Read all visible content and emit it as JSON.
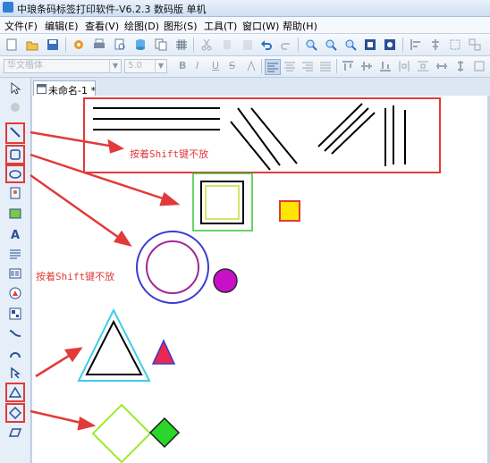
{
  "window": {
    "title": "中琅条码标签打印软件-V6.2.3 数码版 单机"
  },
  "menu": [
    {
      "label": "文件(F)"
    },
    {
      "label": "编辑(E)"
    },
    {
      "label": "查看(V)"
    },
    {
      "label": "绘图(D)"
    },
    {
      "label": "图形(S)"
    },
    {
      "label": "工具(T)"
    },
    {
      "label": "窗口(W)"
    },
    {
      "label": "帮助(H)"
    }
  ],
  "format_toolbar": {
    "font_family": "华文楷体",
    "font_size": "5.0",
    "bold": "B",
    "italic": "I",
    "underline": "U",
    "strike": "S"
  },
  "document_tab": {
    "label": "未命名-1 *"
  },
  "annotations": {
    "shift_hint_top": "按着Shift键不放",
    "shift_hint_left": "按着Shift键不放"
  },
  "colors": {
    "annotation_red": "#e23a3a",
    "rect_outer": "#32c832",
    "rect_middle": "#000000",
    "rect_inner": "#c8dc3c",
    "small_square_fill": "#ffe600",
    "small_square_border": "#e23a3a",
    "circle_outer": "#3c3cd2",
    "circle_inner": "#a02896",
    "small_circle_fill": "#c810c8",
    "triangle_outer": "#3ccfe8",
    "small_triangle_fill": "#e82850",
    "small_triangle_border": "#3c3cd2",
    "diamond_outer": "#9aea2c",
    "small_diamond_fill": "#2ad62a"
  },
  "left_tools": [
    "select-arrow-icon",
    "pan-hand-icon",
    "line-icon",
    "rectangle-icon",
    "ellipse-icon",
    "image-box-icon",
    "picture-icon",
    "text-icon",
    "paragraph-icon",
    "barcode-icon",
    "shape-library-icon",
    "qrcode-icon",
    "curve-icon",
    "arc-icon",
    "polyline-icon",
    "triangle-icon",
    "diamond-icon",
    "parallelogram-icon"
  ],
  "toolbar_icons": [
    "new-file-icon",
    "open-folder-icon",
    "save-icon",
    "settings-gear-icon",
    "print-icon",
    "print-preview-icon",
    "database-icon",
    "copy-doc-icon",
    "grid-icon",
    "cut-icon",
    "copy-icon",
    "paste-icon",
    "undo-icon",
    "redo-icon",
    "zoom-in-icon",
    "zoom-out-icon",
    "zoom-fit-icon",
    "zoom-full-icon",
    "align-left-edge-icon",
    "align-center-icon",
    "align-right-edge-icon",
    "group-icon",
    "ungroup-icon"
  ]
}
